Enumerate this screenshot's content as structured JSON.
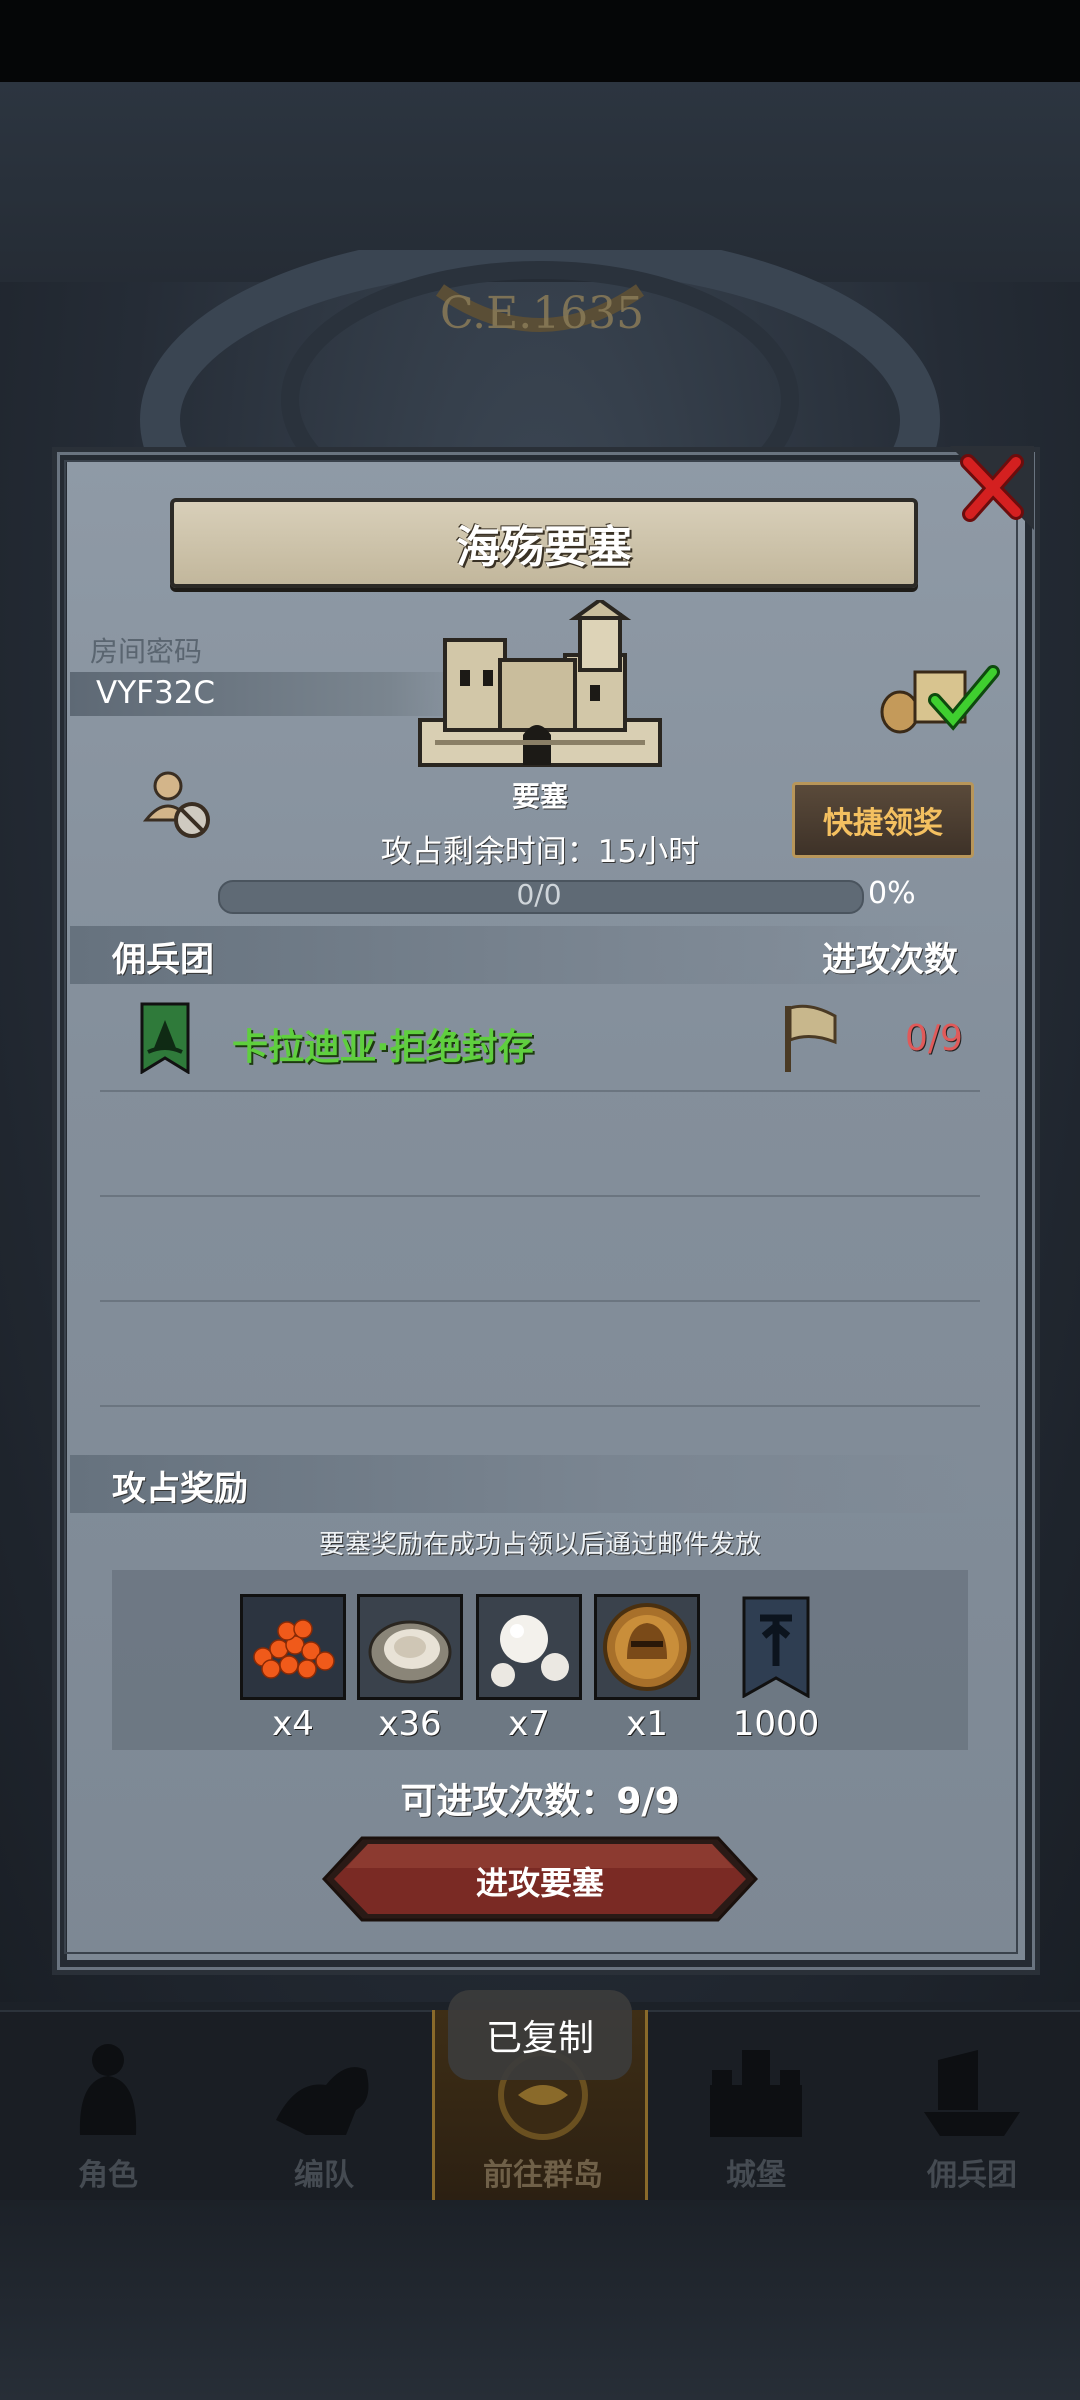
{
  "background": {
    "era_label": "C.E.1635"
  },
  "dialog": {
    "title": "海殇要塞",
    "room_code_label": "房间密码",
    "room_code": "VYF32C",
    "fortress_label": "要塞",
    "time_remaining": "攻占剩余时间：15小时",
    "progress": {
      "text": "0/0",
      "percent_text": "0%",
      "fraction": 0.0
    },
    "quick_claim_label": "快捷领奖",
    "mercenary_header": "佣兵团",
    "attack_count_header": "进攻次数",
    "guild_row": {
      "name": "卡拉迪亚·拒绝封存",
      "attempts": "0/9"
    },
    "rewards_header": "攻占奖励",
    "rewards_note": "要塞奖励在成功占领以后通过邮件发放",
    "rewards": [
      {
        "icon": "roe-icon",
        "count": "x4"
      },
      {
        "icon": "oyster-icon",
        "count": "x36"
      },
      {
        "icon": "pearl-icon",
        "count": "x7"
      },
      {
        "icon": "helmet-medal-icon",
        "count": "x1"
      },
      {
        "icon": "guild-banner-icon",
        "count": "1000"
      }
    ],
    "available_attacks": "可进攻次数：9/9",
    "attack_button_label": "进攻要塞"
  },
  "toast": "已复制",
  "nav": [
    {
      "label": "角色",
      "icon": "knight-icon"
    },
    {
      "label": "编队",
      "icon": "horseman-icon"
    },
    {
      "label": "前往群岛",
      "icon": "map-compass-icon",
      "active": true
    },
    {
      "label": "城堡",
      "icon": "castle-icon"
    },
    {
      "label": "佣兵团",
      "icon": "ship-icon"
    }
  ],
  "colors": {
    "guild_name": "#5fcf3e",
    "attempts": "#e05a5a",
    "quick_claim_text": "#f4c060",
    "panel": "#8a95a1"
  }
}
